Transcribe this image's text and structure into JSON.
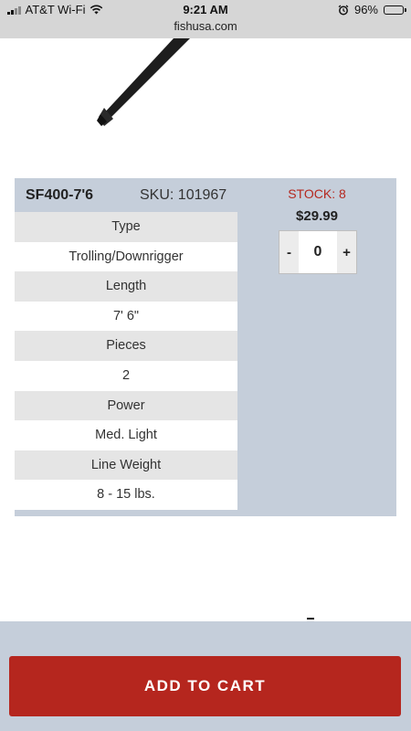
{
  "status_bar": {
    "carrier": "AT&T Wi-Fi",
    "time": "9:21 AM",
    "battery": "96%",
    "battery_level": 0.96
  },
  "url_bar": {
    "domain": "fishusa.com"
  },
  "product": {
    "model": "SF400-7'6",
    "sku": "SKU: 101967",
    "stock": "STOCK: 8",
    "price": "$29.99",
    "quantity": "0",
    "decrement_label": "-",
    "increment_label": "+"
  },
  "specs": [
    {
      "label": "Type",
      "value": "Trolling/Downrigger"
    },
    {
      "label": "Length",
      "value": "7' 6\""
    },
    {
      "label": "Pieces",
      "value": "2"
    },
    {
      "label": "Power",
      "value": "Med. Light"
    },
    {
      "label": "Line Weight",
      "value": "8 - 15 lbs."
    }
  ],
  "actions": {
    "add_to_cart": "ADD TO CART"
  },
  "colors": {
    "accent_red": "#b5261e",
    "panel_bg": "#c5ceda",
    "stock_red": "#b5281f"
  }
}
